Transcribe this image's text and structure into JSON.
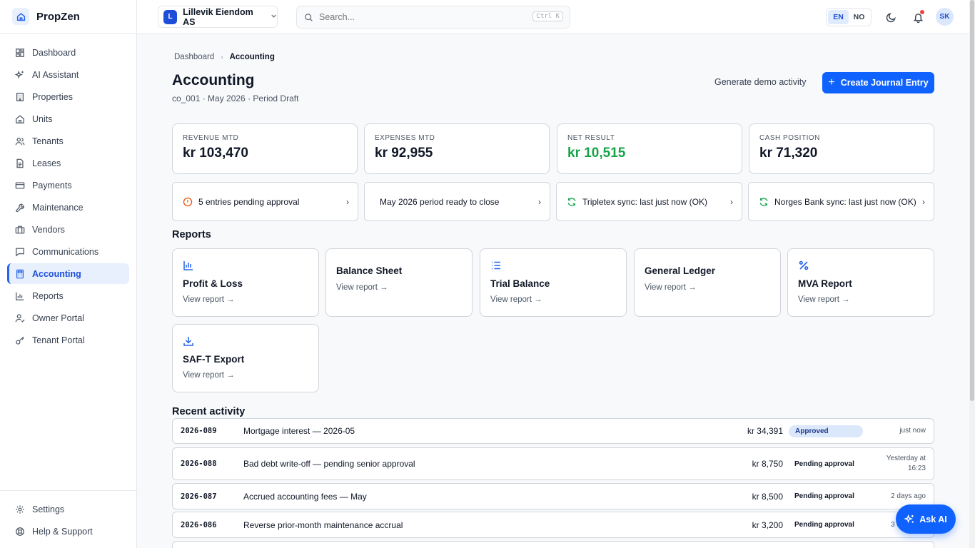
{
  "brand": {
    "name": "PropZen"
  },
  "sidebar": {
    "items": [
      {
        "label": "Dashboard",
        "icon": "dashboard-icon"
      },
      {
        "label": "AI Assistant",
        "icon": "sparkles-icon"
      },
      {
        "label": "Properties",
        "icon": "building-icon"
      },
      {
        "label": "Units",
        "icon": "home-icon"
      },
      {
        "label": "Tenants",
        "icon": "users-icon"
      },
      {
        "label": "Leases",
        "icon": "document-icon"
      },
      {
        "label": "Payments",
        "icon": "credit-card-icon"
      },
      {
        "label": "Maintenance",
        "icon": "wrench-icon"
      },
      {
        "label": "Vendors",
        "icon": "briefcase-icon"
      },
      {
        "label": "Communications",
        "icon": "message-icon"
      },
      {
        "label": "Accounting",
        "icon": "calculator-icon",
        "active": true
      },
      {
        "label": "Reports",
        "icon": "bar-chart-icon"
      },
      {
        "label": "Owner Portal",
        "icon": "user-check-icon"
      },
      {
        "label": "Tenant Portal",
        "icon": "key-icon"
      }
    ],
    "bottom": [
      {
        "label": "Settings",
        "icon": "gear-icon"
      },
      {
        "label": "Help & Support",
        "icon": "lifebuoy-icon"
      }
    ]
  },
  "topbar": {
    "org_initial": "L",
    "org_name": "Lillevik Eiendom AS",
    "search_placeholder": "Search...",
    "search_shortcut": "Ctrl K",
    "lang_en": "EN",
    "lang_no": "NO",
    "avatar_initials": "SK"
  },
  "page": {
    "breadcrumb_root": "Dashboard",
    "breadcrumb_current": "Accounting",
    "title": "Accounting",
    "subtitle": "co_001 · May 2026 · Period Draft",
    "demo_label": "Generate demo activity",
    "create_label": "Create Journal Entry"
  },
  "kpis": [
    {
      "label": "REVENUE MTD",
      "value": "kr 103,470"
    },
    {
      "label": "EXPENSES MTD",
      "value": "kr 92,955"
    },
    {
      "label": "NET RESULT",
      "value": "kr 10,515",
      "positive": true
    },
    {
      "label": "CASH POSITION",
      "value": "kr 71,320"
    }
  ],
  "alerts": [
    {
      "text": "5 entries pending approval",
      "icon": "warning-circle-icon"
    },
    {
      "text": "May 2026 period ready to close",
      "icon": ""
    },
    {
      "text": "Tripletex sync: last just now (OK)",
      "icon": "refresh-icon"
    },
    {
      "text": "Norges Bank sync: last just now (OK)",
      "icon": "refresh-icon"
    }
  ],
  "reports": {
    "heading": "Reports",
    "link_label": "View report →",
    "items": [
      {
        "name": "Profit & Loss",
        "icon": "bar-chart-icon"
      },
      {
        "name": "Balance Sheet",
        "icon": ""
      },
      {
        "name": "Trial Balance",
        "icon": "list-icon"
      },
      {
        "name": "General Ledger",
        "icon": ""
      },
      {
        "name": "MVA Report",
        "icon": "percent-icon"
      },
      {
        "name": "SAF-T Export",
        "icon": "download-icon"
      }
    ]
  },
  "activity": {
    "heading": "Recent activity",
    "rows": [
      {
        "code": "2026-089",
        "description": "Mortgage interest — 2026-05",
        "amount": "kr 34,391",
        "status": "Approved",
        "time": "just now"
      },
      {
        "code": "2026-088",
        "description": "Bad debt write-off — pending senior approval",
        "amount": "kr 8,750",
        "status": "Pending approval",
        "time": "Yesterday at 16:23"
      },
      {
        "code": "2026-087",
        "description": "Accrued accounting fees — May",
        "amount": "kr 8,500",
        "status": "Pending approval",
        "time": "2 days ago"
      },
      {
        "code": "2026-086",
        "description": "Reverse prior-month maintenance accrual",
        "amount": "kr 3,200",
        "status": "Pending approval",
        "time": "3 days ago"
      }
    ]
  },
  "ask_ai": {
    "label": "Ask AI"
  },
  "colors": {
    "accent": "#0f62fe",
    "positive": "#16a34a",
    "warning": "#ea580c",
    "sync_ok": "#16a34a"
  }
}
